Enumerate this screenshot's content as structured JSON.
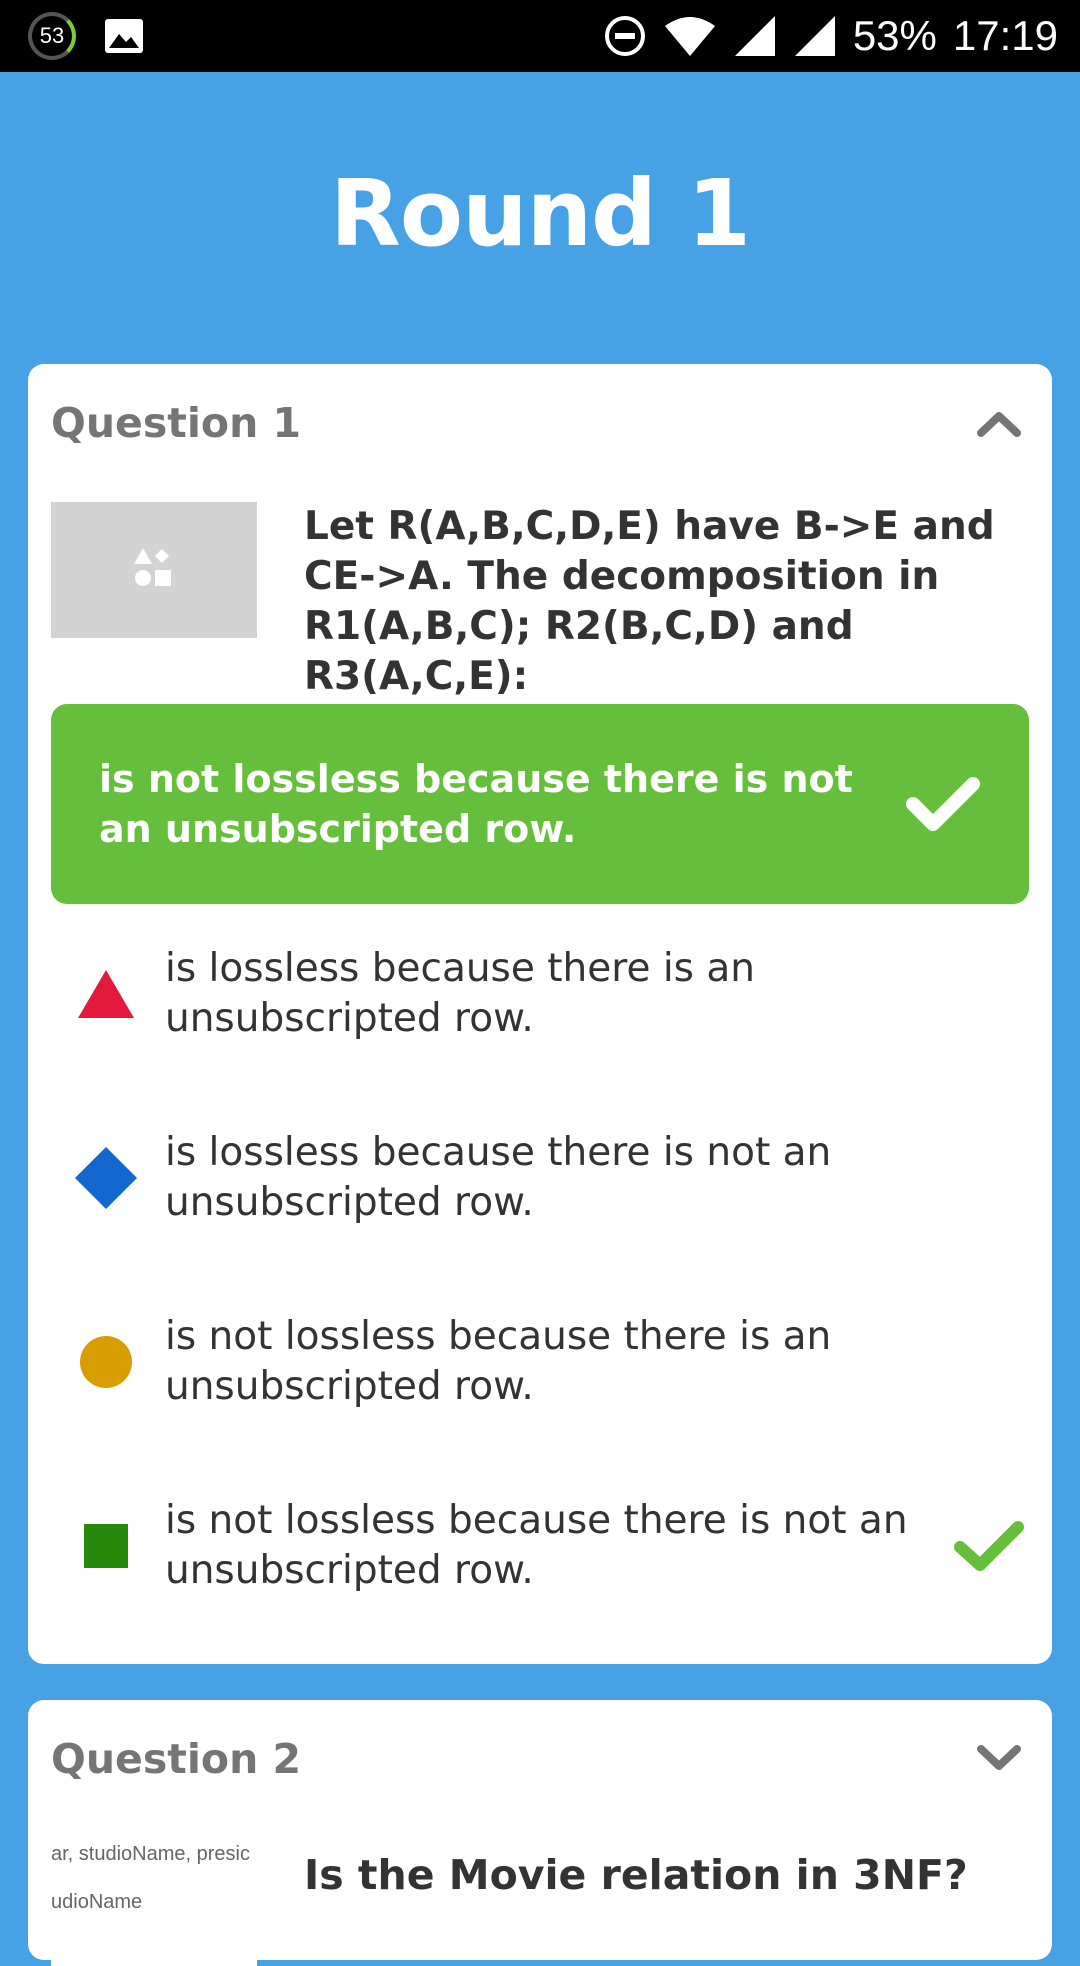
{
  "status_bar": {
    "notification_count": "53",
    "battery_text": "53%",
    "time": "17:19"
  },
  "page": {
    "title": "Round 1"
  },
  "questions": [
    {
      "title": "Question 1",
      "expanded": true,
      "image": "shapes-placeholder-icon",
      "text": "Let R(A,B,C,D,E) have B->E and CE->A. The decomposition in R1(A,B,C); R2(B,C,D) and R3(A,C,E):",
      "selected_answer": "is not lossless because there is not an unsubscripted row.",
      "options": [
        {
          "shape": "triangle",
          "color": "#e21b3c",
          "text": "is lossless because there is an unsubscripted row.",
          "correct": false
        },
        {
          "shape": "diamond",
          "color": "#1368ce",
          "text": "is lossless because there is not an unsubscripted row.",
          "correct": false
        },
        {
          "shape": "circle",
          "color": "#d89e00",
          "text": "is not lossless because there is an unsubscripted row.",
          "correct": false
        },
        {
          "shape": "square",
          "color": "#26890c",
          "text": "is not lossless because there is not an unsubscripted row.",
          "correct": true
        }
      ]
    },
    {
      "title": "Question 2",
      "expanded": false,
      "image_text_lines": [
        "ar, studioName, presic",
        "udioName"
      ],
      "text": "Is the Movie relation in 3NF?"
    }
  ],
  "colors": {
    "background": "#46a2e4",
    "correct_green": "#66bf3c",
    "check_green": "#66bf3c"
  }
}
